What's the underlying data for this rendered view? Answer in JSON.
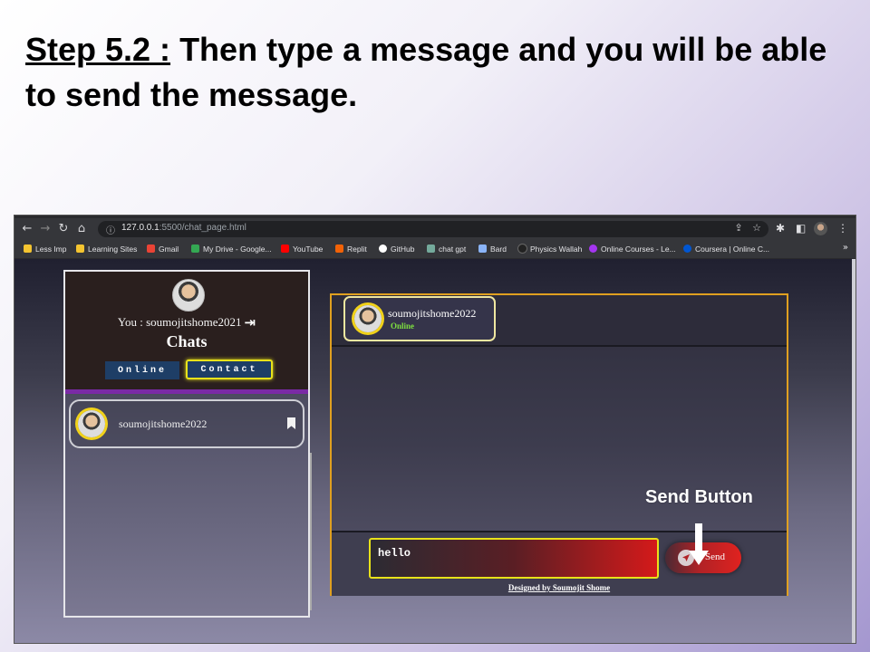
{
  "slide": {
    "step_label": "Step 5.2 :",
    "title_rest": " Then type a message and you will be able to send the message."
  },
  "browser": {
    "address": {
      "host": "127.0.0.1",
      "path": ":5500/chat_page.html"
    },
    "bookmarks": [
      {
        "label": "Less Imp",
        "icon": "folder-icon",
        "color": "#f4c430"
      },
      {
        "label": "Learning Sites",
        "icon": "folder-icon",
        "color": "#f4c430"
      },
      {
        "label": "Gmail",
        "icon": "gmail-icon",
        "color": "#ea4335"
      },
      {
        "label": "My Drive - Google...",
        "icon": "drive-icon",
        "color": "#34a853"
      },
      {
        "label": "YouTube",
        "icon": "youtube-icon",
        "color": "#ff0000"
      },
      {
        "label": "Replit",
        "icon": "replit-icon",
        "color": "#f26207"
      },
      {
        "label": "GitHub",
        "icon": "github-icon",
        "color": "#ffffff"
      },
      {
        "label": "chat gpt",
        "icon": "chatgpt-icon",
        "color": "#74aa9c"
      },
      {
        "label": "Bard",
        "icon": "bard-icon",
        "color": "#8ab4f8"
      },
      {
        "label": "Physics Wallah",
        "icon": "physicswallah-icon",
        "color": "#222222"
      },
      {
        "label": "Online Courses - Le...",
        "icon": "udemy-icon",
        "color": "#a435f0"
      },
      {
        "label": "Coursera | Online C...",
        "icon": "coursera-icon",
        "color": "#0056d2"
      }
    ],
    "more_bookmarks": "»"
  },
  "app": {
    "left": {
      "you_label": "You : soumojitshome2021",
      "chats_title": "Chats",
      "online_button": "Online",
      "contact_button": "Contact",
      "contacts": [
        {
          "name": "soumojitshome2022"
        }
      ]
    },
    "chat": {
      "contact_name": "soumojitshome2022",
      "status": "Online",
      "input_value": "hello",
      "send_label": "Send",
      "footer": "Designed by Soumojit Shome"
    }
  },
  "annotation": {
    "text": "Send Button"
  },
  "colors": {
    "accent_yellow": "#e8e21a",
    "header_purple": "#7a2aa5",
    "online_green": "#7ee040",
    "send_red": "#e0221f"
  }
}
